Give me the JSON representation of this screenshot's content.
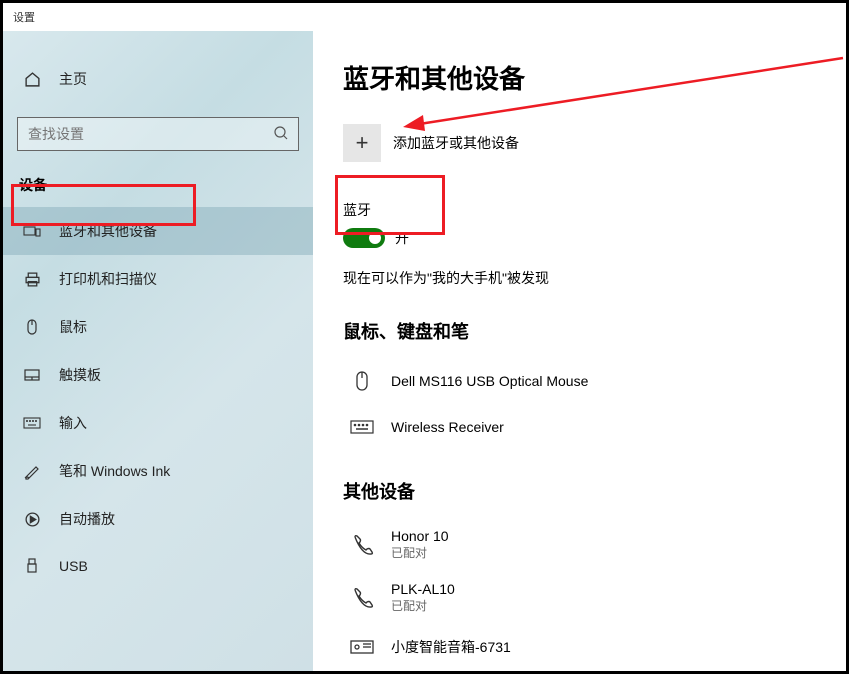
{
  "window": {
    "title": "设置"
  },
  "sidebar": {
    "home": "主页",
    "search_placeholder": "查找设置",
    "section": "设备",
    "items": [
      {
        "label": "蓝牙和其他设备",
        "active": true
      },
      {
        "label": "打印机和扫描仪"
      },
      {
        "label": "鼠标"
      },
      {
        "label": "触摸板"
      },
      {
        "label": "输入"
      },
      {
        "label": "笔和 Windows Ink"
      },
      {
        "label": "自动播放"
      },
      {
        "label": "USB"
      }
    ]
  },
  "main": {
    "title": "蓝牙和其他设备",
    "add_device": "添加蓝牙或其他设备",
    "bluetooth_label": "蓝牙",
    "toggle_state": "开",
    "discover_text": "现在可以作为\"我的大手机\"被发现",
    "mkb_section": "鼠标、键盘和笔",
    "mkb_devices": [
      {
        "name": "Dell MS116 USB Optical Mouse",
        "type": "mouse"
      },
      {
        "name": "Wireless Receiver",
        "type": "keyboard"
      }
    ],
    "other_section": "其他设备",
    "other_devices": [
      {
        "name": "Honor 10",
        "status": "已配对",
        "type": "phone"
      },
      {
        "name": "PLK-AL10",
        "status": "已配对",
        "type": "phone"
      },
      {
        "name": "小度智能音箱-6731",
        "status": "",
        "type": "speaker"
      }
    ]
  }
}
